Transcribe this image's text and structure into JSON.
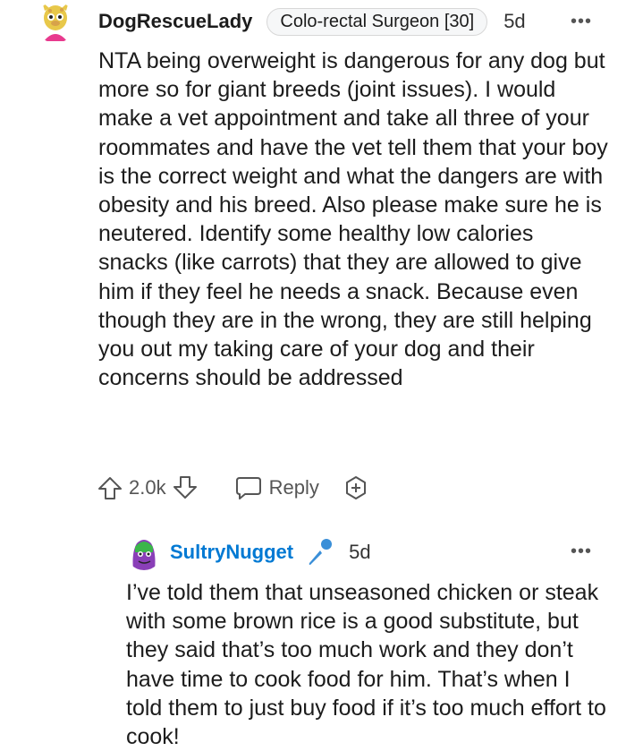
{
  "comment": {
    "username": "DogRescueLady",
    "flair": "Colo-rectal Surgeon [30]",
    "time": "5d",
    "more_label": "•••",
    "body": "NTA being overweight is dangerous for any dog but more so for giant breeds (joint issues). I would make a vet appointment and take all three of your roommates and have the vet tell them that your boy is the correct weight and what the dangers are with obesity and his breed. Also please make sure he is neutered. Identify some healthy low calories snacks (like carrots) that they are allowed to give him if they feel he needs a snack. Because even though they are in the wrong, they are still helping you out my taking care of your dog and their concerns should be addressed",
    "vote_count": "2.0k",
    "reply_label": "Reply",
    "icons": {
      "upvote": "arrow-up-icon",
      "downvote": "arrow-down-icon",
      "reply": "chat-bubble-icon",
      "award": "award-plus-icon",
      "more": "ellipsis-icon"
    }
  },
  "reply": {
    "username": "SultryNugget",
    "time": "5d",
    "more_label": "•••",
    "body": "I’ve told them that unseasoned chicken or steak with some brown rice is a good substitute, but they said that’s too much work and they don’t have time to cook food for him. That’s when I told them to just buy food if it’s too much effort to cook!",
    "icons": {
      "op_badge": "microphone-icon"
    }
  },
  "colors": {
    "op_blue": "#0079d3",
    "text": "#1c1c1c",
    "muted": "#555555",
    "thread_line": "#e5e5e5"
  }
}
